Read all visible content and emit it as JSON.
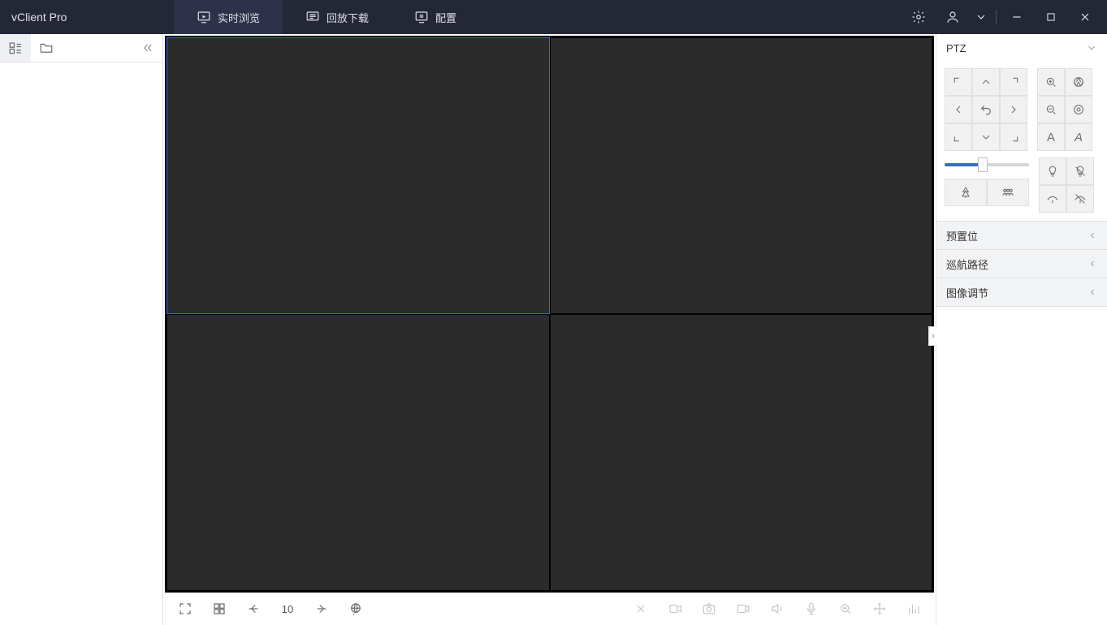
{
  "app": {
    "title": "vClient Pro"
  },
  "tabs": [
    {
      "label": "实时浏览",
      "icon": "play-monitor"
    },
    {
      "label": "回放下载",
      "icon": "playback"
    },
    {
      "label": "配置",
      "icon": "config-monitor"
    }
  ],
  "active_tab_index": 0,
  "top_right_icons": [
    "settings",
    "user",
    "chevron-down",
    "|",
    "minimize",
    "maximize",
    "close"
  ],
  "left_toolbar": {
    "buttons": [
      "device-list",
      "folder"
    ],
    "active_index": 0
  },
  "view": {
    "layout": "2x2",
    "selected_index": 0
  },
  "bottom": {
    "page_count": "10",
    "left_buttons": [
      "fullscreen",
      "grid-layout",
      "prev-page"
    ],
    "right_buttons": [
      "close-all",
      "talk",
      "snapshot",
      "record",
      "audio",
      "mic",
      "zoom",
      "ptz-move",
      "stats"
    ]
  },
  "ptz": {
    "section_title": "PTZ",
    "speed_percent": 45,
    "dpad": [
      "up-left",
      "up",
      "up-right",
      "left",
      "home",
      "right",
      "down-left",
      "down",
      "down-right"
    ],
    "aux": [
      "zoom-in",
      "iris-open",
      "zoom-out",
      "iris-close",
      "focus-near",
      "focus-far"
    ],
    "extra2x2": [
      "light",
      "light-off",
      "wiper",
      "wiper-off"
    ],
    "bottom_pair": [
      "preset-tree",
      "preset-grid"
    ]
  },
  "right_sections": [
    {
      "label": "预置位"
    },
    {
      "label": "巡航路径"
    },
    {
      "label": "图像调节"
    }
  ]
}
